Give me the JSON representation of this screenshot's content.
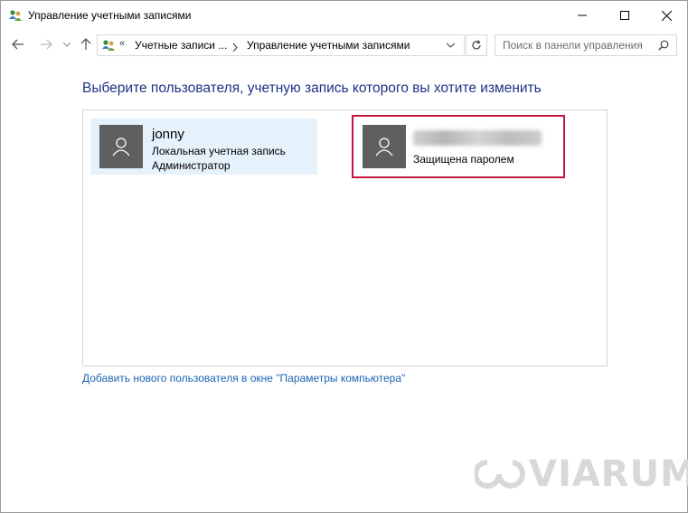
{
  "window": {
    "title": "Управление учетными записями"
  },
  "address": {
    "breadcrumb_prefix": "«",
    "crumb1": "Учетные записи ...",
    "crumb2": "Управление учетными записями"
  },
  "search": {
    "placeholder": "Поиск в панели управления"
  },
  "main": {
    "heading": "Выберите пользователя, учетную запись которого вы хотите изменить",
    "users": [
      {
        "name": "jonny",
        "line1": "Локальная учетная запись",
        "line2": "Администратор",
        "selected": true
      },
      {
        "name": "",
        "line1": "Защищена паролем",
        "selected": false,
        "highlighted": true
      }
    ],
    "add_user_link": "Добавить нового пользователя в окне \"Параметры компьютера\""
  },
  "watermark": {
    "text": "VIARUM"
  },
  "colors": {
    "heading": "#1e3287",
    "link": "#1a64b4",
    "selection": "#e5f1fb",
    "highlight_border": "#c3163d",
    "avatar": "#5f5f5f"
  }
}
